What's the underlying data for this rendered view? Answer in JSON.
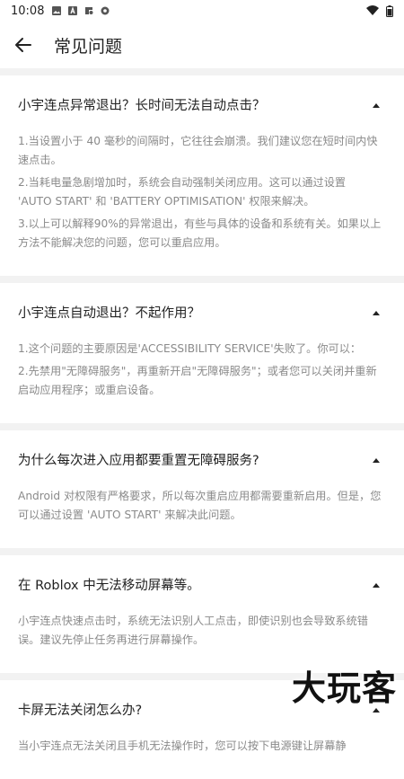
{
  "status": {
    "time": "10:08"
  },
  "appbar": {
    "title": "常见问题"
  },
  "faqs": [
    {
      "question": "小宇连点异常退出？长时间无法自动点击？",
      "answers": [
        "1.当设置小于 40 毫秒的间隔时，它往往会崩溃。我们建议您在短时间内快速点击。",
        "2.当耗电量急剧增加时，系统会自动强制关闭应用。这可以通过设置 'AUTO START' 和 'BATTERY OPTIMISATION' 权限来解决。",
        "3.以上可以解释90%的异常退出，有些与具体的设备和系统有关。如果以上方法不能解决您的问题，您可以重启应用。"
      ]
    },
    {
      "question": "小宇连点自动退出？不起作用？",
      "answers": [
        "1.这个问题的主要原因是'ACCESSIBILITY SERVICE'失败了。你可以：",
        "2.先禁用\"无障碍服务\"，再重新开启\"无障碍服务\"；或者您可以关闭并重新启动应用程序；或重启设备。"
      ]
    },
    {
      "question": "为什么每次进入应用都要重置无障碍服务?",
      "answers": [
        "Android 对权限有严格要求，所以每次重启应用都需要重新启用。但是，您可以通过设置 'AUTO START' 来解决此问题。"
      ]
    },
    {
      "question": "在 Roblox 中无法移动屏幕等。",
      "answers": [
        "小宇连点快速点击时，系统无法识别人工点击，即使识别也会导致系统错误。建议先停止任务再进行屏幕操作。"
      ]
    },
    {
      "question": "卡屏无法关闭怎么办?",
      "answers": [
        "当小宇连点无法关闭且手机无法操作时，您可以按下电源键让屏幕静"
      ]
    }
  ],
  "watermark": "大玩客"
}
